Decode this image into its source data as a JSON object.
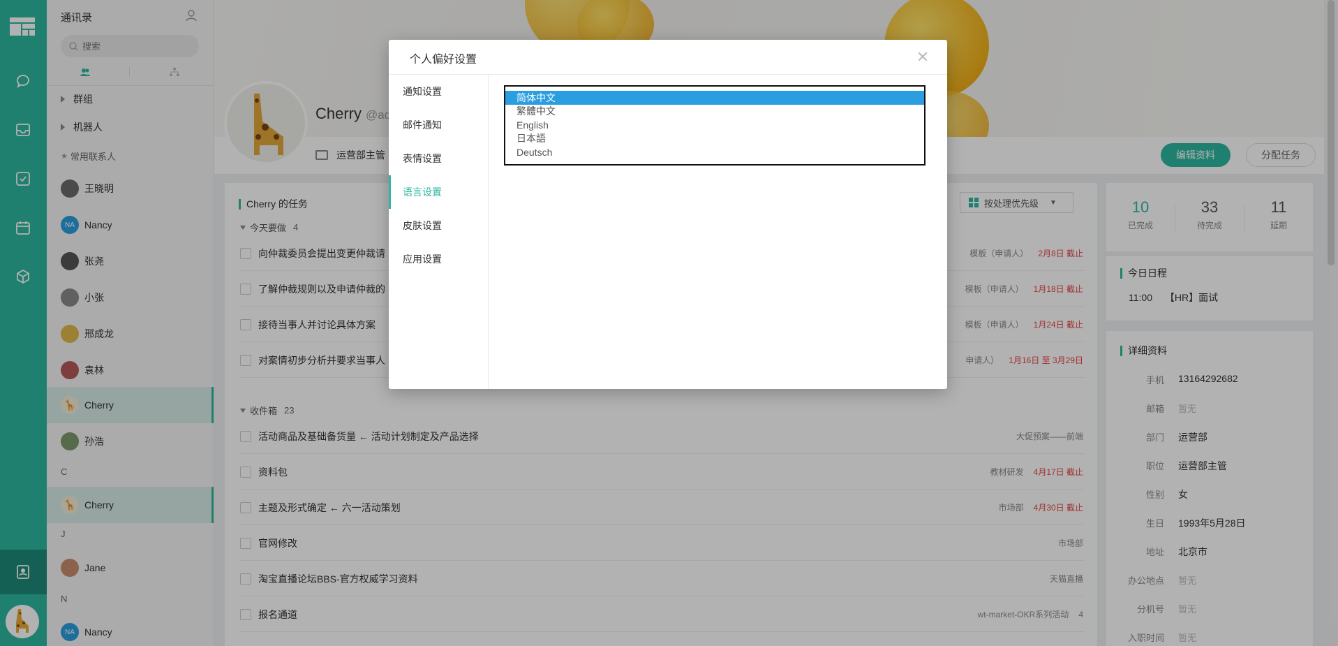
{
  "sidebar": {
    "icons": [
      "chat-icon",
      "inbox-icon",
      "task-icon",
      "calendar-icon",
      "cube-icon",
      "contacts-icon"
    ]
  },
  "contacts": {
    "title": "通讯录",
    "search_placeholder": "搜索",
    "groups": [
      {
        "label": "群组"
      },
      {
        "label": "机器人"
      }
    ],
    "favorites_label": "常用联系人",
    "favorites": [
      {
        "name": "王晓明",
        "avatar": "photo"
      },
      {
        "name": "Nancy",
        "avatar": "NA"
      },
      {
        "name": "张尧",
        "avatar": "photo"
      },
      {
        "name": "小张",
        "avatar": "photo"
      },
      {
        "name": "邢成龙",
        "avatar": "photo"
      },
      {
        "name": "袁林",
        "avatar": "photo"
      },
      {
        "name": "Cherry",
        "avatar": "giraffe"
      },
      {
        "name": "孙浩",
        "avatar": "photo"
      }
    ],
    "sections": [
      {
        "letter": "C",
        "items": [
          {
            "name": "Cherry",
            "avatar": "giraffe"
          }
        ]
      },
      {
        "letter": "J",
        "items": [
          {
            "name": "Jane",
            "avatar": "photo"
          }
        ]
      },
      {
        "letter": "N",
        "items": [
          {
            "name": "Nancy",
            "avatar": "NA"
          }
        ]
      }
    ]
  },
  "profile": {
    "name": "Cherry",
    "handle": "@ad",
    "role": "运营部主管",
    "edit_button": "编辑资料",
    "assign_button": "分配任务"
  },
  "tasks": {
    "title": "Cherry 的任务",
    "sort_label": "按处理优先级",
    "today": {
      "label": "今天要做",
      "count": "4",
      "items": [
        {
          "text": "向仲裁委员会提出变更仲裁请",
          "project": "模板（申请人）",
          "due": "2月8日 截止"
        },
        {
          "text": "了解仲裁规则以及申请仲裁的",
          "project": "模板（申请人）",
          "due": "1月18日 截止"
        },
        {
          "text": "接待当事人并讨论具体方案",
          "project": "模板（申请人）",
          "due": "1月24日 截止"
        },
        {
          "text": "对案情初步分析并要求当事人",
          "project": "申请人）",
          "due": "1月16日 至 3月29日"
        }
      ]
    },
    "inbox": {
      "label": "收件箱",
      "count": "23",
      "items": [
        {
          "text": "活动商品及基础备货量 ← 活动计划制定及产品选择",
          "project": "大促预案——前端",
          "due": ""
        },
        {
          "text": "资料包",
          "project": "教材研发",
          "due": "4月17日 截止"
        },
        {
          "text": "主题及形式确定 ← 六一活动策划",
          "project": "市场部",
          "due": "4月30日 截止"
        },
        {
          "text": "官网修改",
          "project": "市场部",
          "due": ""
        },
        {
          "text": "淘宝直播论坛BBS-官方权威学习资料",
          "project": "天猫直播",
          "due": ""
        },
        {
          "text": "报名通道",
          "project": "wt-market-OKR系列活动",
          "due": "",
          "subtasks": "4"
        }
      ]
    }
  },
  "stats": [
    {
      "value": "10",
      "label": "已完成"
    },
    {
      "value": "33",
      "label": "待完成"
    },
    {
      "value": "11",
      "label": "延期"
    }
  ],
  "schedule": {
    "title": "今日日程",
    "time": "11:00",
    "event": "【HR】面试"
  },
  "details": {
    "title": "详细资料",
    "rows": [
      {
        "key": "手机",
        "value": "13164292682",
        "muted": false
      },
      {
        "key": "邮箱",
        "value": "暂无",
        "muted": true
      },
      {
        "key": "部门",
        "value": "运营部",
        "muted": false
      },
      {
        "key": "职位",
        "value": "运营部主管",
        "muted": false
      },
      {
        "key": "性别",
        "value": "女",
        "muted": false
      },
      {
        "key": "生日",
        "value": "1993年5月28日",
        "muted": false
      },
      {
        "key": "地址",
        "value": "北京市",
        "muted": false
      },
      {
        "key": "办公地点",
        "value": "暂无",
        "muted": true
      },
      {
        "key": "分机号",
        "value": "暂无",
        "muted": true
      },
      {
        "key": "入职时间",
        "value": "暂无",
        "muted": true
      }
    ]
  },
  "modal": {
    "title": "个人偏好设置",
    "close": "✕",
    "nav": [
      "通知设置",
      "邮件通知",
      "表情设置",
      "语言设置",
      "皮肤设置",
      "应用设置"
    ],
    "active_nav": 3,
    "languages": [
      "简体中文",
      "繁體中文",
      "English",
      "日本語",
      "Deutsch"
    ],
    "selected_language": 0
  },
  "colors": {
    "accent": "#2eb8a1",
    "selection": "#2a9ee0",
    "due": "#e64545"
  }
}
